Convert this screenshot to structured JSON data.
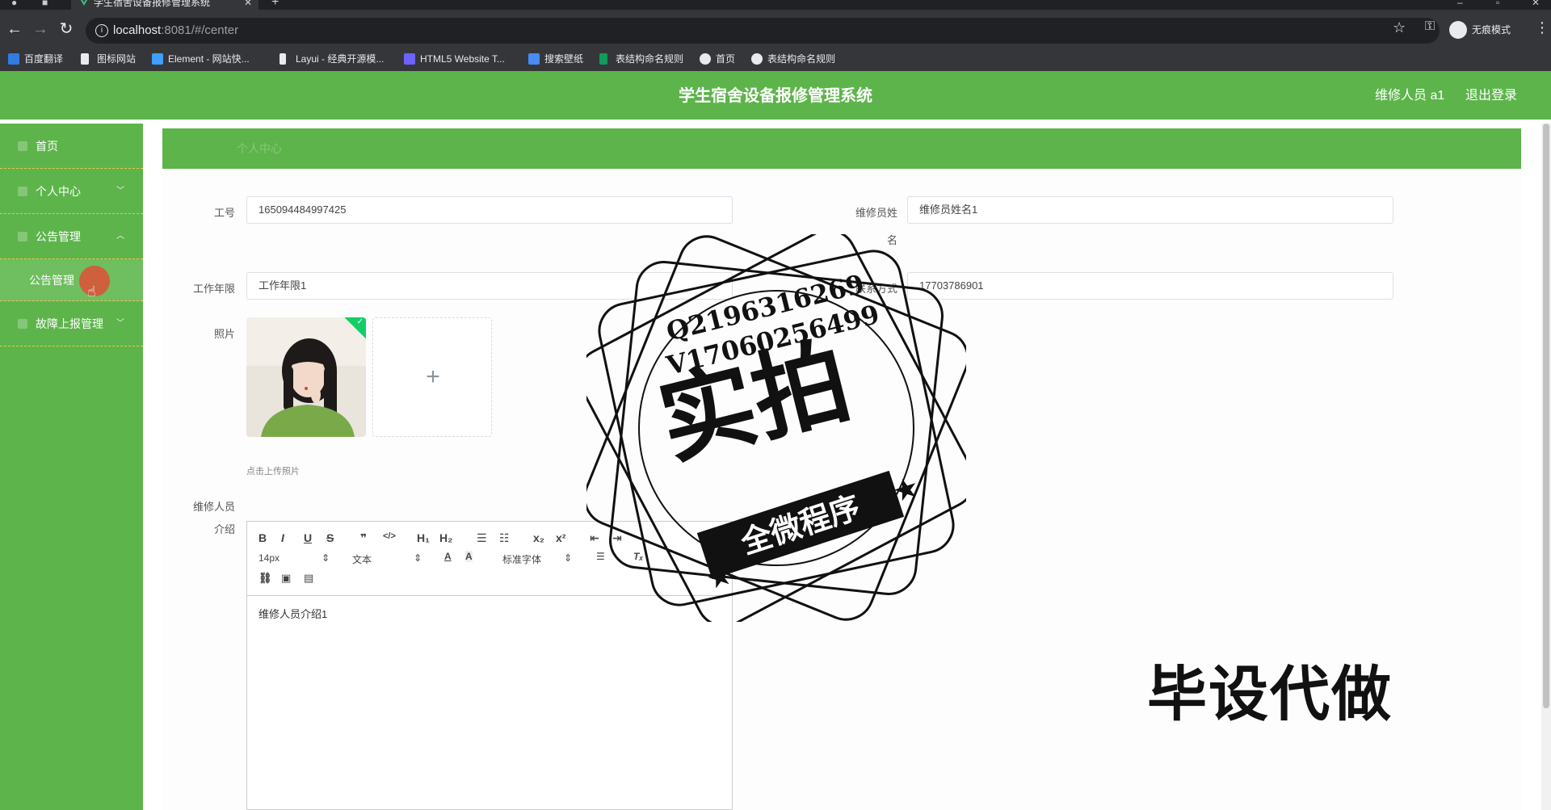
{
  "browser": {
    "tab_title": "学生宿舍设备报修管理系统",
    "url_host": "localhost",
    "url_rest": ":8081/#/center",
    "profile_label": "无痕模式",
    "bookmarks": [
      {
        "label": "百度翻译",
        "color": "#2f7de1"
      },
      {
        "label": "图标网站",
        "color": "#e8eaed"
      },
      {
        "label": "Element - 网站快...",
        "color": "#409eff"
      },
      {
        "label": "Layui - 经典开源模...",
        "color": "#e8eaed"
      },
      {
        "label": "HTML5 Website T...",
        "color": "#6c63ff"
      },
      {
        "label": "搜索壁纸",
        "color": "#4a8af4"
      },
      {
        "label": "表结构命名规则",
        "color": "#0f9d58"
      },
      {
        "label": "首页",
        "color": "#e8eaed"
      },
      {
        "label": "表结构命名规则",
        "color": "#e8eaed"
      }
    ]
  },
  "header": {
    "title": "学生宿舍设备报修管理系统",
    "user": "维修人员 a1",
    "logout": "退出登录"
  },
  "sidebar": {
    "items": [
      {
        "label": "首页"
      },
      {
        "label": "个人中心",
        "chevron": "﹀"
      },
      {
        "label": "公告管理",
        "chevron": "︿"
      },
      {
        "label": "公告管理",
        "sub": true
      },
      {
        "label": "故障上报管理",
        "chevron": "﹀"
      }
    ]
  },
  "breadcrumb": "个人中心",
  "form": {
    "job_no_label": "工号",
    "job_no_value": "165094484997425",
    "name_label_1": "维修员姓",
    "name_label_2": "名",
    "name_value": "维修员姓名1",
    "years_label": "工作年限",
    "years_value": "工作年限1",
    "contact_label": "联系方式",
    "contact_value": "17703786901",
    "photo_label": "照片",
    "upload_tip": "点击上传照片",
    "intro_label_1": "维修人员",
    "intro_label_2": "介绍",
    "intro_value": "维修人员介绍1"
  },
  "editor": {
    "font_size": "14px",
    "block_format": "文本",
    "font_family": "标准字体"
  },
  "watermark": {
    "line1": "Q2196316269",
    "line2": "V17060256499",
    "big": "实拍",
    "ribbon": "全微程序",
    "corner": "毕设代做"
  }
}
